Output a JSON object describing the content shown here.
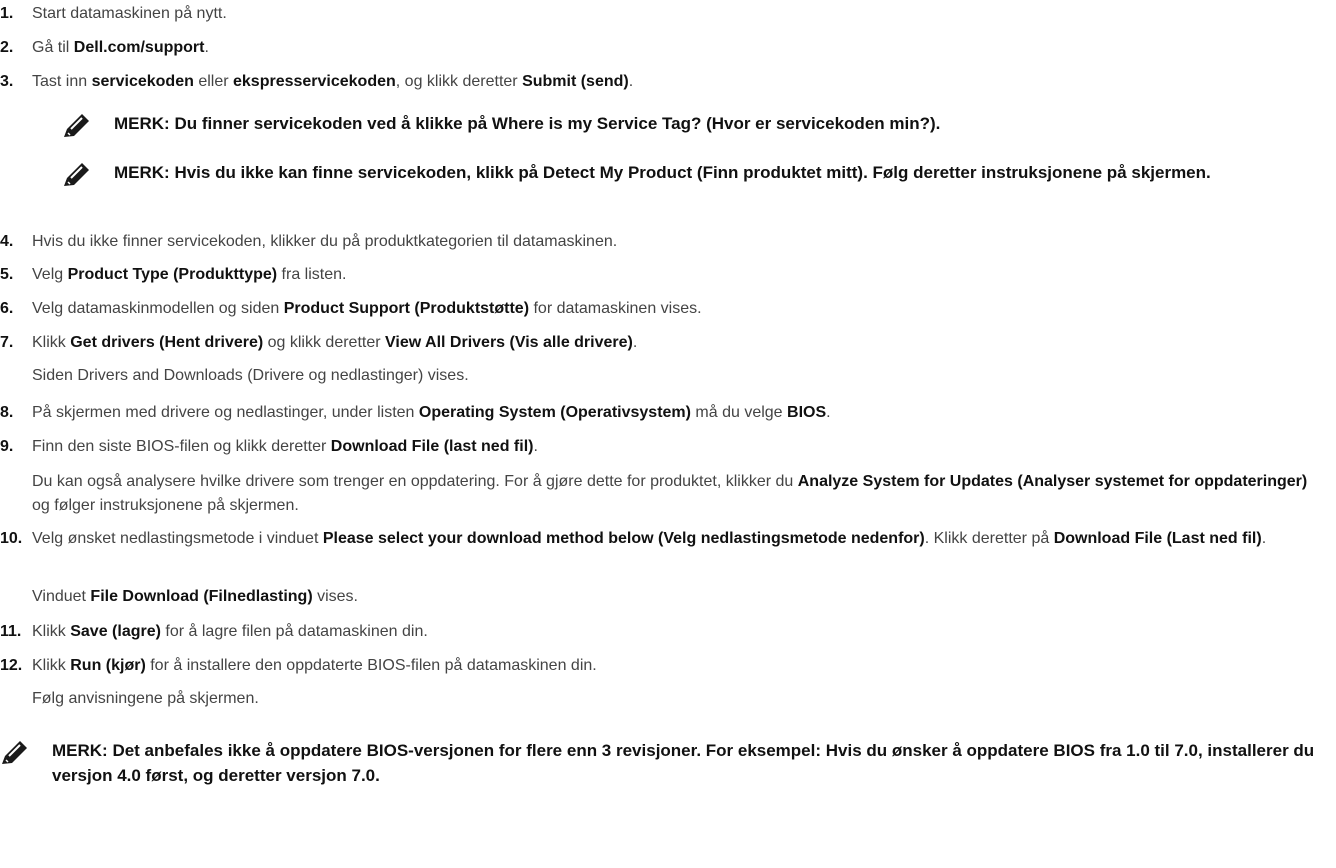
{
  "steps": [
    {
      "num": "1.",
      "parts": [
        {
          "t": "Start datamaskinen på nytt."
        }
      ]
    },
    {
      "num": "2.",
      "parts": [
        {
          "t": "Gå til "
        },
        {
          "t": "Dell.com/support",
          "b": true
        },
        {
          "t": "."
        }
      ]
    },
    {
      "num": "3.",
      "parts": [
        {
          "t": "Tast inn "
        },
        {
          "t": "servicekoden",
          "b": true
        },
        {
          "t": " eller "
        },
        {
          "t": "ekspresservicekoden",
          "b": true
        },
        {
          "t": ", og klikk deretter "
        },
        {
          "t": "Submit (send)",
          "b": true
        },
        {
          "t": "."
        }
      ]
    },
    {
      "num": "4.",
      "parts": [
        {
          "t": "Hvis du ikke finner servicekoden, klikker du på produktkategorien til datamaskinen."
        }
      ]
    },
    {
      "num": "5.",
      "parts": [
        {
          "t": "Velg "
        },
        {
          "t": "Product Type (Produkttype)",
          "b": true
        },
        {
          "t": " fra listen."
        }
      ]
    },
    {
      "num": "6.",
      "parts": [
        {
          "t": "Velg datamaskinmodellen og siden "
        },
        {
          "t": "Product Support (Produktstøtte)",
          "b": true
        },
        {
          "t": " for datamaskinen vises."
        }
      ]
    },
    {
      "num": "7.",
      "parts": [
        {
          "t": "Klikk "
        },
        {
          "t": "Get drivers (Hent drivere)",
          "b": true
        },
        {
          "t": " og klikk deretter "
        },
        {
          "t": "View All Drivers (Vis alle drivere)",
          "b": true
        },
        {
          "t": "."
        }
      ]
    },
    {
      "num": "8.",
      "parts": [
        {
          "t": "På skjermen med drivere og nedlastinger, under listen "
        },
        {
          "t": "Operating System (Operativsystem)",
          "b": true
        },
        {
          "t": " må du velge "
        },
        {
          "t": "BIOS",
          "b": true
        },
        {
          "t": "."
        }
      ]
    },
    {
      "num": "9.",
      "parts": [
        {
          "t": "Finn den siste BIOS-filen og klikk deretter "
        },
        {
          "t": "Download File (last ned fil)",
          "b": true
        },
        {
          "t": "."
        }
      ]
    },
    {
      "num": "10.",
      "parts": [
        {
          "t": "Velg ønsket nedlastingsmetode i vinduet "
        },
        {
          "t": "Please select your download method below (Velg nedlastingsmetode nedenfor)",
          "b": true
        },
        {
          "t": ". Klikk deretter på "
        },
        {
          "t": "Download File (Last ned fil)",
          "b": true
        },
        {
          "t": "."
        }
      ]
    },
    {
      "num": "11.",
      "parts": [
        {
          "t": "Klikk "
        },
        {
          "t": "Save (lagre)",
          "b": true
        },
        {
          "t": " for å lagre filen på datamaskinen din."
        }
      ]
    },
    {
      "num": "12.",
      "parts": [
        {
          "t": "Klikk "
        },
        {
          "t": "Run (kjør)",
          "b": true
        },
        {
          "t": " for å installere den oppdaterte BIOS-filen på datamaskinen din."
        }
      ]
    }
  ],
  "sub_texts": [
    {
      "parts": [
        {
          "t": "Siden Drivers and Downloads (Drivere og nedlastinger) vises."
        }
      ]
    },
    {
      "parts": [
        {
          "t": "Du kan også analysere hvilke drivere som trenger en oppdatering. For å gjøre dette for produktet, klikker du "
        },
        {
          "t": "Analyze System for Updates (Analyser systemet for oppdateringer)",
          "b": true
        },
        {
          "t": " og følger instruksjonene på skjermen."
        }
      ]
    },
    {
      "parts": [
        {
          "t": "Vinduet "
        },
        {
          "t": "File Download (Filnedlasting)",
          "b": true
        },
        {
          "t": " vises."
        }
      ]
    },
    {
      "parts": [
        {
          "t": "Følg anvisningene på skjermen."
        }
      ]
    }
  ],
  "notes": [
    {
      "text": "MERK: Du finner servicekoden ved å klikke på Where is my Service Tag? (Hvor er servicekoden min?)."
    },
    {
      "text": "MERK: Hvis du ikke kan finne servicekoden, klikk på Detect My Product (Finn produktet mitt). Følg deretter instruksjonene på skjermen."
    },
    {
      "text": "MERK: Det anbefales ikke å oppdatere BIOS-versjonen for flere enn 3 revisjoner. For eksempel: Hvis du ønsker å oppdatere BIOS fra 1.0 til 7.0, installerer du versjon 4.0 først, og deretter versjon 7.0."
    }
  ],
  "icon": {
    "name": "note-pencil-icon",
    "color": "#1a1a1a"
  }
}
